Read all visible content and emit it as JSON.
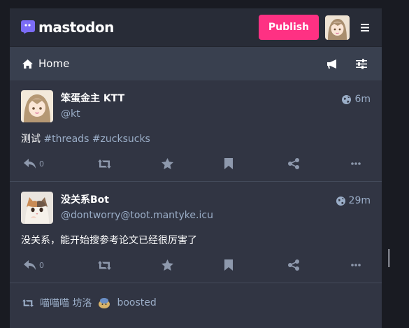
{
  "app": {
    "brand": "mastodon",
    "accent": "#fe3183"
  },
  "topbar": {
    "publish_label": "Publish"
  },
  "column": {
    "title": "Home"
  },
  "statuses": [
    {
      "display_name": "笨蛋金主 KTT",
      "acct": "@kt",
      "time": "6m",
      "text": "测试",
      "tags": [
        "#threads",
        "#zucksucks"
      ],
      "reply_count": "0"
    },
    {
      "display_name": "没关系Bot",
      "acct": "@dontworry@toot.mantyke.icu",
      "time": "29m",
      "text": "没关系，能开始搜参考论文已经很厉害了",
      "tags": [],
      "reply_count": "0"
    }
  ],
  "boost": {
    "prefix": "喵喵喵 坊洛",
    "suffix": "boosted"
  }
}
